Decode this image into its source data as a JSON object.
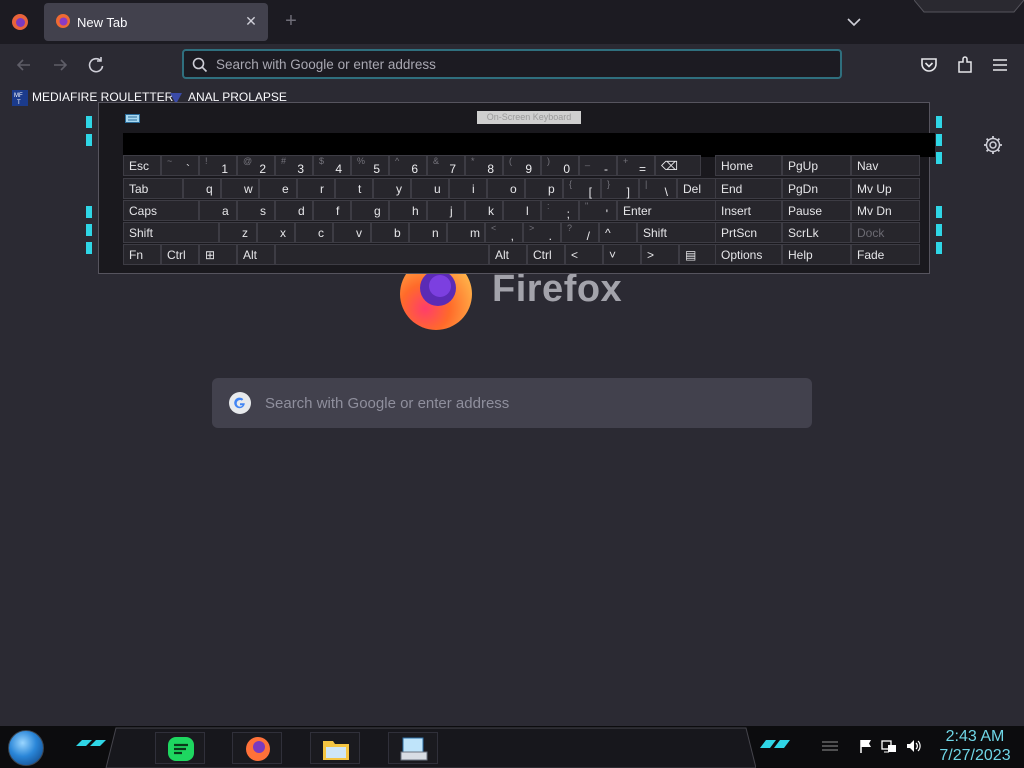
{
  "browser": {
    "tab": {
      "title": "New Tab"
    },
    "urlbar": {
      "placeholder": "Search with Google or enter address"
    },
    "bookmarks": [
      {
        "label": "MEDIAFIRE ROULETTER",
        "icon": "mft-icon"
      },
      {
        "label": "ANAL PROLAPSE",
        "icon": "bookmark-icon"
      }
    ]
  },
  "newtab": {
    "logo_text": "Firefox",
    "search_placeholder": "Search with Google or enter address"
  },
  "osk": {
    "title": "On-Screen Keyboard",
    "rows": [
      [
        {
          "main": "Esc"
        },
        {
          "shift": "~",
          "main": "`"
        },
        {
          "shift": "!",
          "main": "1"
        },
        {
          "shift": "@",
          "main": "2"
        },
        {
          "shift": "#",
          "main": "3"
        },
        {
          "shift": "$",
          "main": "4"
        },
        {
          "shift": "%",
          "main": "5"
        },
        {
          "shift": "^",
          "main": "6"
        },
        {
          "shift": "&",
          "main": "7"
        },
        {
          "shift": "*",
          "main": "8"
        },
        {
          "shift": "(",
          "main": "9"
        },
        {
          "shift": ")",
          "main": "0"
        },
        {
          "shift": "_",
          "main": "-"
        },
        {
          "shift": "+",
          "main": "="
        },
        {
          "main": "⌫"
        }
      ],
      [
        {
          "main": "Tab"
        },
        {
          "main": "q"
        },
        {
          "main": "w"
        },
        {
          "main": "e"
        },
        {
          "main": "r"
        },
        {
          "main": "t"
        },
        {
          "main": "y"
        },
        {
          "main": "u"
        },
        {
          "main": "i"
        },
        {
          "main": "o"
        },
        {
          "main": "p"
        },
        {
          "shift": "{",
          "main": "["
        },
        {
          "shift": "}",
          "main": "]"
        },
        {
          "shift": "|",
          "main": "\\"
        },
        {
          "main": "Del"
        }
      ],
      [
        {
          "main": "Caps"
        },
        {
          "main": "a"
        },
        {
          "main": "s"
        },
        {
          "main": "d"
        },
        {
          "main": "f"
        },
        {
          "main": "g"
        },
        {
          "main": "h"
        },
        {
          "main": "j"
        },
        {
          "main": "k"
        },
        {
          "main": "l"
        },
        {
          "shift": ":",
          "main": ";"
        },
        {
          "shift": "\"",
          "main": "'"
        },
        {
          "main": "Enter"
        }
      ],
      [
        {
          "main": "Shift"
        },
        {
          "main": "z"
        },
        {
          "main": "x"
        },
        {
          "main": "c"
        },
        {
          "main": "v"
        },
        {
          "main": "b"
        },
        {
          "main": "n"
        },
        {
          "main": "m"
        },
        {
          "shift": "<",
          "main": ","
        },
        {
          "shift": ">",
          "main": "."
        },
        {
          "shift": "?",
          "main": "/"
        },
        {
          "main": "^"
        },
        {
          "main": "Shift"
        }
      ],
      [
        {
          "main": "Fn"
        },
        {
          "main": "Ctrl"
        },
        {
          "main": "⊞"
        },
        {
          "main": "Alt"
        },
        {
          "main": ""
        },
        {
          "main": "Alt"
        },
        {
          "main": "Ctrl"
        },
        {
          "main": "<"
        },
        {
          "main": "˅"
        },
        {
          "main": ">"
        },
        {
          "main": "▤"
        }
      ]
    ],
    "side_keys": [
      [
        "Home",
        "PgUp",
        "Nav"
      ],
      [
        "End",
        "PgDn",
        "Mv Up"
      ],
      [
        "Insert",
        "Pause",
        "Mv Dn"
      ],
      [
        "PrtScn",
        "ScrLk",
        "Dock"
      ],
      [
        "Options",
        "Help",
        "Fade"
      ]
    ]
  },
  "taskbar": {
    "time": "2:43 AM",
    "date": "7/27/2023"
  },
  "colors": {
    "accent_cyan": "#2fd6e6",
    "chrome_dark": "#1c1b22",
    "chrome_mid": "#2b2a33"
  }
}
